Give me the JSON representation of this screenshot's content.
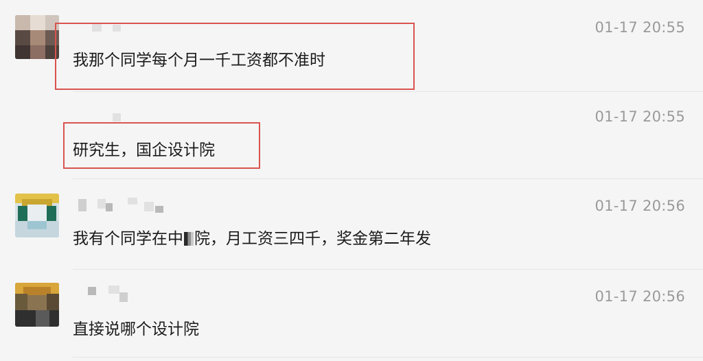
{
  "messages": [
    {
      "timestamp": "01-17 20:55",
      "text": "我那个同学每个月一千工资都不准时"
    },
    {
      "timestamp": "01-17 20:55",
      "text": "研究生，国企设计院"
    },
    {
      "timestamp": "01-17 20:56",
      "text_before": "我有个同学在中",
      "text_after": "院，月工资三四千，奖金第二年发"
    },
    {
      "timestamp": "01-17 20:56",
      "text": "直接说哪个设计院"
    }
  ],
  "icons": {
    "avatar": "user-avatar-icon"
  },
  "colors": {
    "highlight": "#d9534f",
    "timestamp": "#9a9a9a",
    "background": "#f5f5f5"
  }
}
